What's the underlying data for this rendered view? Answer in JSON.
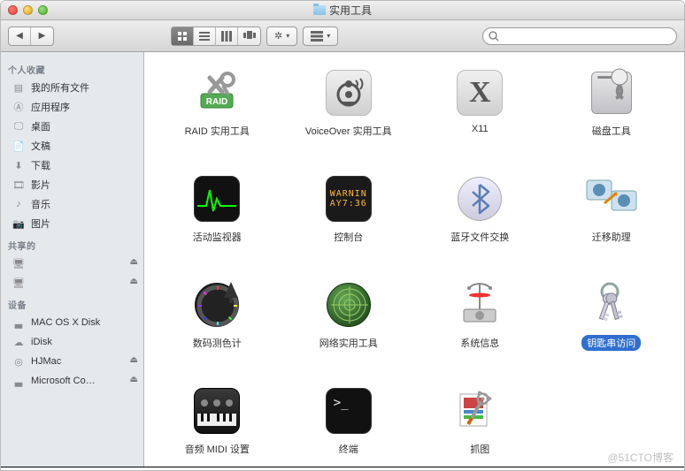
{
  "window": {
    "title": "实用工具"
  },
  "sidebar": {
    "sections": [
      {
        "header": "个人收藏",
        "items": [
          {
            "icon": "all-files-icon",
            "label": "我的所有文件"
          },
          {
            "icon": "apps-icon",
            "label": "应用程序"
          },
          {
            "icon": "desktop-icon",
            "label": "桌面"
          },
          {
            "icon": "documents-icon",
            "label": "文稿"
          },
          {
            "icon": "downloads-icon",
            "label": "下载"
          },
          {
            "icon": "movies-icon",
            "label": "影片"
          },
          {
            "icon": "music-icon",
            "label": "音乐"
          },
          {
            "icon": "pictures-icon",
            "label": "图片"
          }
        ]
      },
      {
        "header": "共享的",
        "items": [
          {
            "icon": "shared-computer-icon",
            "label": "",
            "eject": true
          },
          {
            "icon": "shared-computer-icon",
            "label": "",
            "eject": true
          }
        ]
      },
      {
        "header": "设备",
        "items": [
          {
            "icon": "hd-icon",
            "label": "MAC OS X Disk"
          },
          {
            "icon": "idisk-icon",
            "label": "iDisk"
          },
          {
            "icon": "optical-disc-icon",
            "label": "HJMac",
            "eject": true
          },
          {
            "icon": "hd-icon",
            "label": "Microsoft Co…",
            "eject": true
          }
        ]
      }
    ]
  },
  "toolbar": {
    "view_modes": [
      "icon-view",
      "list-view",
      "column-view",
      "coverflow-view"
    ],
    "active_view": 0,
    "search_placeholder": ""
  },
  "grid": {
    "items": [
      {
        "id": "raid",
        "label": "RAID 实用工具",
        "icon": "raid-utility-icon",
        "selected": false
      },
      {
        "id": "voiceover",
        "label": "VoiceOver 实用工具",
        "icon": "voiceover-icon",
        "selected": false
      },
      {
        "id": "x11",
        "label": "X11",
        "icon": "x11-icon",
        "selected": false
      },
      {
        "id": "diskutil",
        "label": "磁盘工具",
        "icon": "disk-utility-icon",
        "selected": false
      },
      {
        "id": "activity",
        "label": "活动监视器",
        "icon": "activity-monitor-icon",
        "selected": false
      },
      {
        "id": "console",
        "label": "控制台",
        "icon": "console-icon",
        "selected": false
      },
      {
        "id": "bluetooth",
        "label": "蓝牙文件交换",
        "icon": "bluetooth-icon",
        "selected": false
      },
      {
        "id": "migration",
        "label": "迁移助理",
        "icon": "migration-icon",
        "selected": false
      },
      {
        "id": "colorimeter",
        "label": "数码测色计",
        "icon": "digital-color-meter-icon",
        "selected": false
      },
      {
        "id": "network",
        "label": "网络实用工具",
        "icon": "network-utility-icon",
        "selected": false
      },
      {
        "id": "sysinfo",
        "label": "系统信息",
        "icon": "system-info-icon",
        "selected": false
      },
      {
        "id": "keychain",
        "label": "钥匙串访问",
        "icon": "keychain-icon",
        "selected": true
      },
      {
        "id": "audio-midi",
        "label": "音频 MIDI 设置",
        "icon": "audio-midi-icon",
        "selected": false
      },
      {
        "id": "terminal",
        "label": "终端",
        "icon": "terminal-icon",
        "selected": false
      },
      {
        "id": "grab",
        "label": "抓图",
        "icon": "grab-icon",
        "selected": false
      }
    ]
  },
  "watermark": "@51CTO博客"
}
